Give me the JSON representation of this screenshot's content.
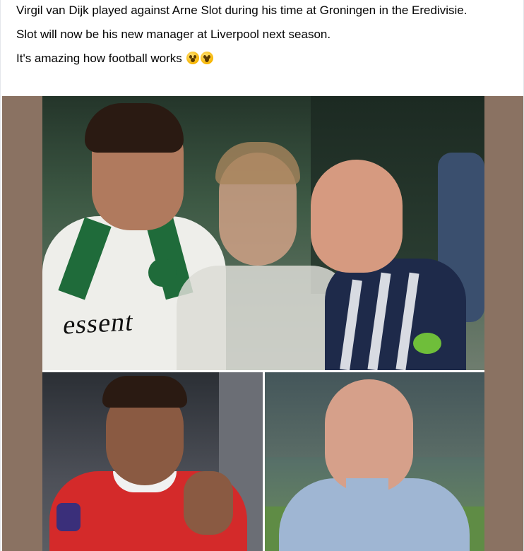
{
  "post": {
    "paragraphs": [
      "Virgil van Dijk played against Arne Slot during his time at Groningen in the Eredivisie.",
      "Slot will now be his new manager at Liverpool next season.",
      "It's amazing how football works"
    ],
    "emojis": [
      "astonished-face-emoji",
      "face-screaming-in-fear-emoji"
    ]
  },
  "media": {
    "jersey_sponsor_text": "essent",
    "colors": {
      "frame_background": "#8a7262",
      "groningen_green": "#1f6b3a",
      "liverpool_red": "#d42a2a",
      "shirt_blue": "#9fb6d3"
    }
  }
}
